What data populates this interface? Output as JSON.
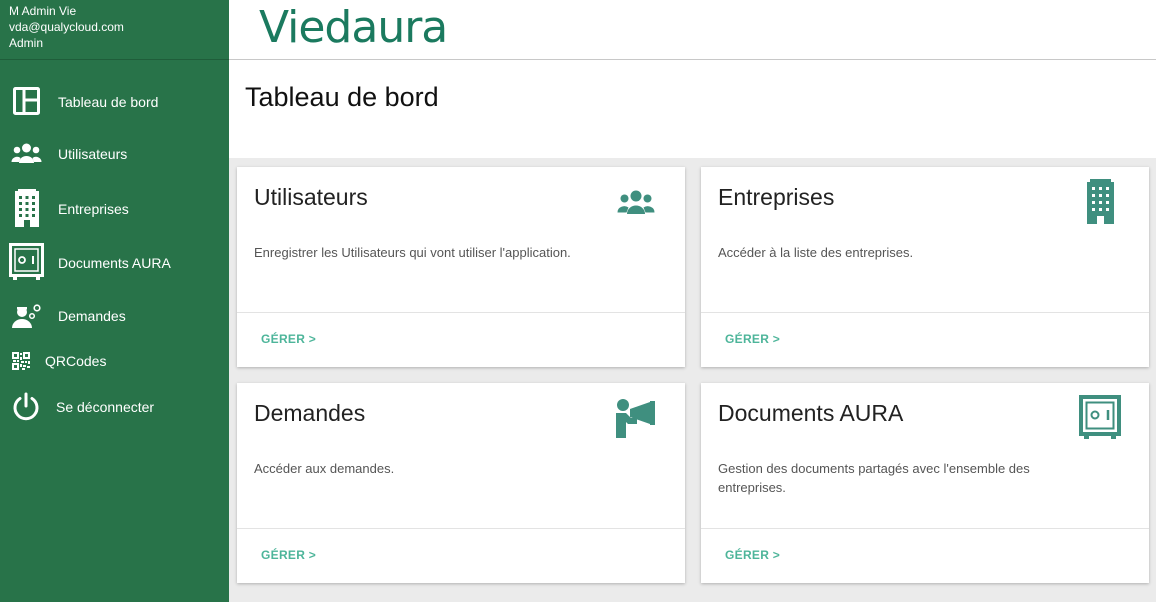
{
  "user": {
    "name": "M Admin Vie",
    "email": "vda@qualycloud.com",
    "role": "Admin"
  },
  "sidebar": {
    "items": [
      {
        "label": "Tableau de bord",
        "icon": "dashboard-icon"
      },
      {
        "label": "Utilisateurs",
        "icon": "users-icon"
      },
      {
        "label": "Entreprises",
        "icon": "building-icon"
      },
      {
        "label": "Documents AURA",
        "icon": "safe-icon"
      },
      {
        "label": "Demandes",
        "icon": "user-gear-icon"
      },
      {
        "label": "QRCodes",
        "icon": "qrcode-icon"
      },
      {
        "label": "Se déconnecter",
        "icon": "power-icon"
      }
    ]
  },
  "header": {
    "logo_text": "Viedaura"
  },
  "page": {
    "title": "Tableau de bord"
  },
  "cards": [
    {
      "title": "Utilisateurs",
      "description": "Enregistrer les Utilisateurs qui vont utiliser l'application.",
      "action": "GÉRER >",
      "icon": "users-icon"
    },
    {
      "title": "Entreprises",
      "description": "Accéder à la liste des entreprises.",
      "action": "GÉRER >",
      "icon": "building-icon"
    },
    {
      "title": "Demandes",
      "description": "Accéder aux demandes.",
      "action": "GÉRER >",
      "icon": "megaphone-user-icon"
    },
    {
      "title": "Documents AURA",
      "description": "Gestion des documents partagés avec l'ensemble des entreprises.",
      "action": "GÉRER >",
      "icon": "safe-icon"
    }
  ],
  "colors": {
    "sidebar": "#287349",
    "accent": "#4db59a",
    "icon": "#3f8f7f",
    "logo": "#1b7a5f"
  }
}
